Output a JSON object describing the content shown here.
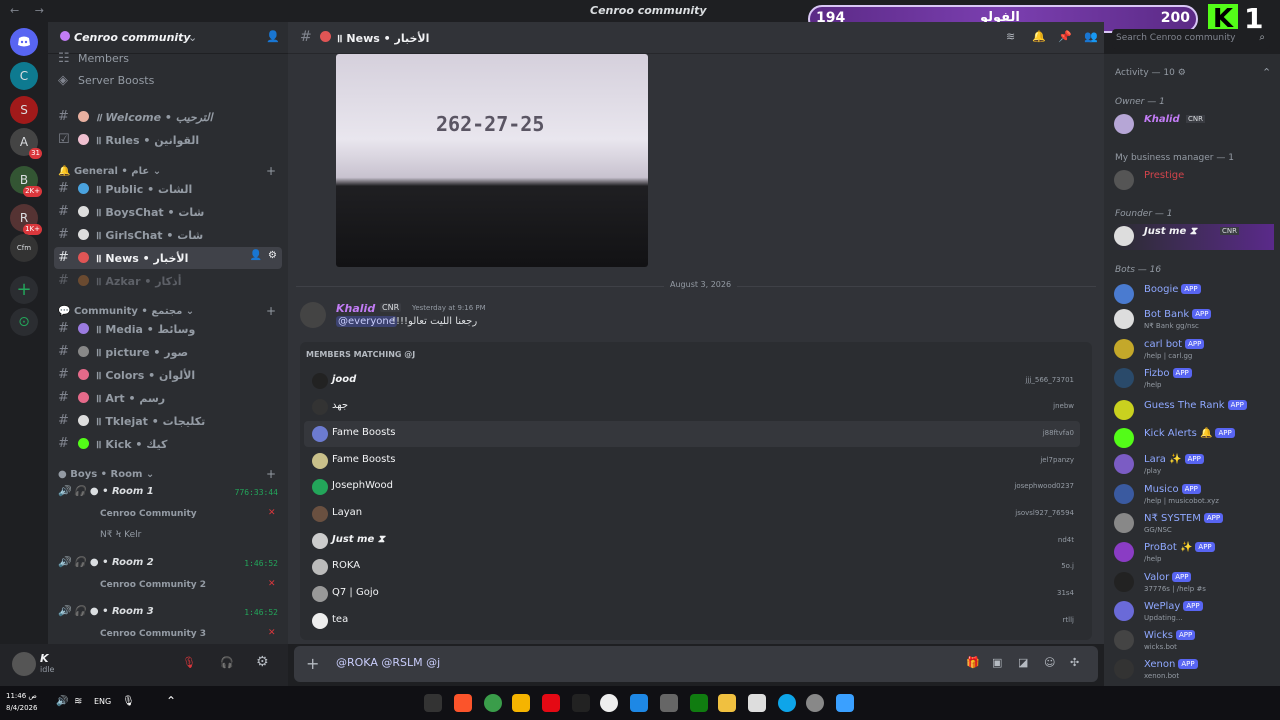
{
  "window": {
    "title": "Cenroo community",
    "nav": "← →"
  },
  "overlay": {
    "left_value": "194",
    "center_text": "الفولو",
    "right_value": "200",
    "kick_letter": "K",
    "kick_number": "1"
  },
  "servers": [
    {
      "label": "C",
      "badge": ""
    },
    {
      "label": "S",
      "badge": ""
    },
    {
      "label": "A",
      "badge": "31"
    },
    {
      "label": "B",
      "badge": "2K+"
    },
    {
      "label": "R",
      "badge": "1K+"
    },
    {
      "label": "Cfm",
      "badge": ""
    }
  ],
  "guild": {
    "name": "Cenroo community"
  },
  "channels": {
    "members_label": "Members",
    "boosts_label": "Server Boosts",
    "top": [
      {
        "label": "॥ Welcome • الترحيب"
      },
      {
        "label": "॥ Rules • القوانين"
      }
    ],
    "cat_general": "General • عام",
    "general": [
      {
        "label": "॥ Public • الشات"
      },
      {
        "label": "॥ BoysChat • شات"
      },
      {
        "label": "॥ GirlsChat • شات"
      },
      {
        "label": "॥ News • الأخبار"
      },
      {
        "label": "॥ Azkar • أذكار"
      }
    ],
    "cat_community": "Community • مجتمع",
    "community": [
      {
        "label": "॥ Media • وسائط"
      },
      {
        "label": "॥ picture • صور"
      },
      {
        "label": "॥ Colors • الألوان"
      },
      {
        "label": "॥ Art • رسم"
      },
      {
        "label": "॥ Tklejat • تكليجات"
      },
      {
        "label": "॥ Kick • كيك"
      }
    ],
    "cat_boys": "Boys • Room",
    "rooms": [
      {
        "name": "Room 1",
        "time": "776:33:44",
        "user": "Cenroo Community"
      },
      {
        "name": "Room 2",
        "time": "1:46:52",
        "user": "Cenroo Community 2"
      },
      {
        "name": "Room 3",
        "time": "1:46:52",
        "user": "Cenroo Community 3"
      }
    ],
    "room1_extra_user": "N₹ Ϟ Kelr"
  },
  "user_panel": {
    "name": "K",
    "status": "idle"
  },
  "header": {
    "channel": "॥ News • الأخبار",
    "search_placeholder": "Search Cenroo community"
  },
  "image_text": "262-27-25",
  "date_divider": "August 3, 2026",
  "message": {
    "author": "Khalid",
    "tag": "CNR",
    "time": "Yesterday at 9:16 PM",
    "mention": "@everyone",
    "text": "!!!!رجعنا الليت تعالو"
  },
  "popup": {
    "header": "MEMBERS MATCHING @J",
    "rows": [
      {
        "name": "jood",
        "user": "jjj_566_73701"
      },
      {
        "name": "جهد",
        "user": "jnebw"
      },
      {
        "name": "Fame Boosts",
        "user": "j88ftvfa0"
      },
      {
        "name": "Fame Boosts",
        "user": "jel7panzy"
      },
      {
        "name": "JosephWood",
        "user": "josephwood0237"
      },
      {
        "name": "Layan",
        "user": "jsovsl927_76594"
      },
      {
        "name": "Just me ⧗",
        "user": "nd4t"
      },
      {
        "name": "ROKA",
        "user": "5o.j"
      },
      {
        "name": "Q7 | Gojo",
        "user": "31s4"
      },
      {
        "name": "tea",
        "user": "rtllj"
      }
    ]
  },
  "input": {
    "value": "@ROKA @RSLM @j",
    "add_label": "+"
  },
  "members": {
    "activity": "Activity — 10",
    "owner_header": "Owner — 1",
    "owner": {
      "name": "Khalid",
      "tag": "CNR"
    },
    "manager_header": "My business manager — 1",
    "manager": {
      "name": "Prestige"
    },
    "founder_header": "Founder — 1",
    "founder": {
      "name": "Just me ⧗",
      "tag": "CNR"
    },
    "bots_header": "Bots — 16",
    "app_tag": "APP",
    "bots": [
      {
        "name": "Boogie",
        "sub": ""
      },
      {
        "name": "Bot Bank",
        "sub": "N₹ Bank gg/nsc"
      },
      {
        "name": "carl bot",
        "sub": "/help | carl.gg"
      },
      {
        "name": "Fizbo",
        "sub": "/help"
      },
      {
        "name": "Guess The Rank",
        "sub": ""
      },
      {
        "name": "Kick Alerts 🔔",
        "sub": ""
      },
      {
        "name": "Lara ✨",
        "sub": "/play"
      },
      {
        "name": "Musico",
        "sub": "/help | musicobot.xyz"
      },
      {
        "name": "N₹ SYSTEM",
        "sub": "GG/NSC"
      },
      {
        "name": "ProBot ✨",
        "sub": "/help"
      },
      {
        "name": "Valor",
        "sub": "37776s | /help #s"
      },
      {
        "name": "WePlay",
        "sub": "Updating..."
      },
      {
        "name": "Wicks",
        "sub": "wicks.bot"
      },
      {
        "name": "Xenon",
        "sub": "xenon.bot"
      }
    ]
  },
  "taskbar": {
    "time": "ص 11:46",
    "date": "8/4/2026",
    "lang": "ENG"
  },
  "colors": {
    "accent": "#5865f2",
    "owner": "#c27cf5",
    "manager": "#d1444b",
    "bot_name": "#8fa8ff",
    "online": "#23a55a"
  }
}
